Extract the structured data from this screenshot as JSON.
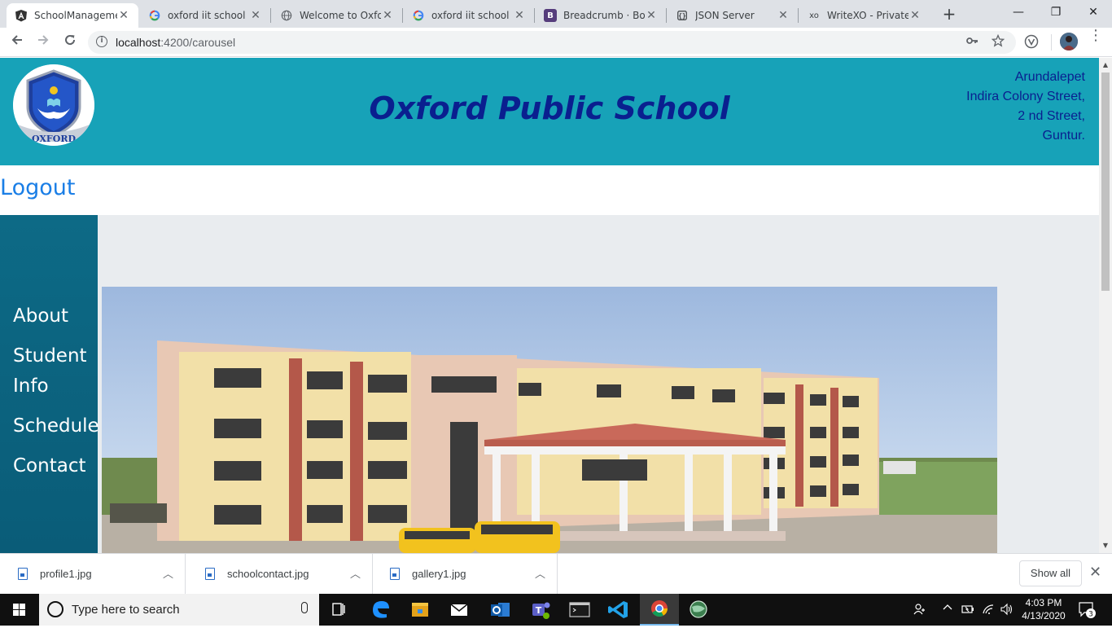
{
  "browser": {
    "tabs": [
      {
        "title": "SchoolManageme",
        "icon": "angular-icon",
        "active": true
      },
      {
        "title": "oxford iit school p",
        "icon": "google-icon"
      },
      {
        "title": "Welcome to Oxfor",
        "icon": "globe-icon"
      },
      {
        "title": "oxford iit school a",
        "icon": "google-icon"
      },
      {
        "title": "Breadcrumb · Boot",
        "icon": "bootstrap-icon"
      },
      {
        "title": "JSON Server",
        "icon": "json-server-icon"
      },
      {
        "title": "WriteXO - Private,",
        "icon": "writexo-icon"
      }
    ],
    "favicon_text": {
      "bootstrap": "B",
      "writexo": "xo"
    },
    "url_host": "localhost",
    "url_rest": ":4200/carousel"
  },
  "page": {
    "school_name": "Oxford Public School",
    "logo_text": "OXFORD",
    "address": [
      "Arundalepet",
      "Indira Colony Street,",
      "2 nd Street,",
      "Guntur."
    ],
    "logout_label": "Logout",
    "nav": [
      "About",
      "Student Info",
      "Schedule",
      "Contact"
    ],
    "colors": {
      "header": "#17a2b8",
      "title": "#0a1f8f",
      "sidebar": "#0d6a86",
      "link": "#1a7ee6",
      "content_bg": "#e9ecef"
    }
  },
  "downloads": {
    "files": [
      "profile1.jpg",
      "schoolcontact.jpg",
      "gallery1.jpg"
    ],
    "show_all_label": "Show all"
  },
  "taskbar": {
    "search_placeholder": "Type here to search",
    "time": "4:03 PM",
    "date": "4/13/2020",
    "notification_count": "3"
  }
}
